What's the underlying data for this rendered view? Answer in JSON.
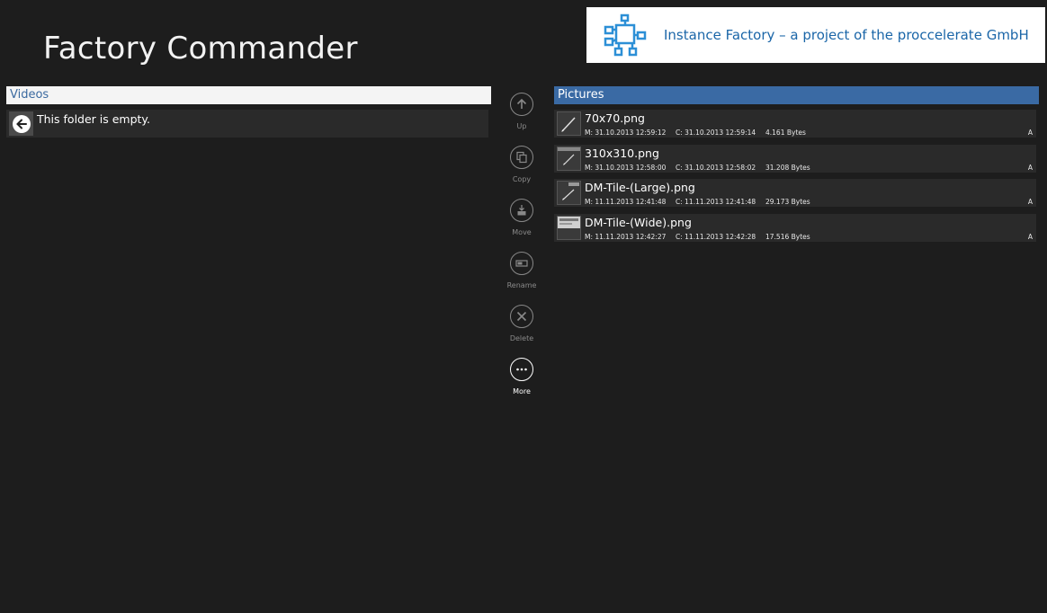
{
  "app": {
    "title": "Factory Commander"
  },
  "banner": {
    "text": "Instance Factory – a project of the proccelerate GmbH"
  },
  "left_pane": {
    "header": "Videos",
    "empty_message": "This folder is empty."
  },
  "toolbar": {
    "up": "Up",
    "copy": "Copy",
    "move": "Move",
    "rename": "Rename",
    "delete": "Delete",
    "more": "More"
  },
  "right_pane": {
    "header": "Pictures",
    "files": [
      {
        "name": "70x70.png",
        "modified": "M: 31.10.2013 12:59:12",
        "created": "C: 31.10.2013 12:59:14",
        "size": "4.161 Bytes",
        "attr": "A"
      },
      {
        "name": "310x310.png",
        "modified": "M: 31.10.2013 12:58:00",
        "created": "C: 31.10.2013 12:58:02",
        "size": "31.208 Bytes",
        "attr": "A"
      },
      {
        "name": "DM-Tile-(Large).png",
        "modified": "M: 11.11.2013 12:41:48",
        "created": "C: 11.11.2013 12:41:48",
        "size": "29.173 Bytes",
        "attr": "A"
      },
      {
        "name": "DM-Tile-(Wide).png",
        "modified": "M: 11.11.2013 12:42:27",
        "created": "C: 11.11.2013 12:42:28",
        "size": "17.516 Bytes",
        "attr": "A"
      }
    ]
  },
  "colors": {
    "background": "#1d1d1d",
    "accent": "#3a6aa4",
    "banner_text": "#1b66a8"
  }
}
